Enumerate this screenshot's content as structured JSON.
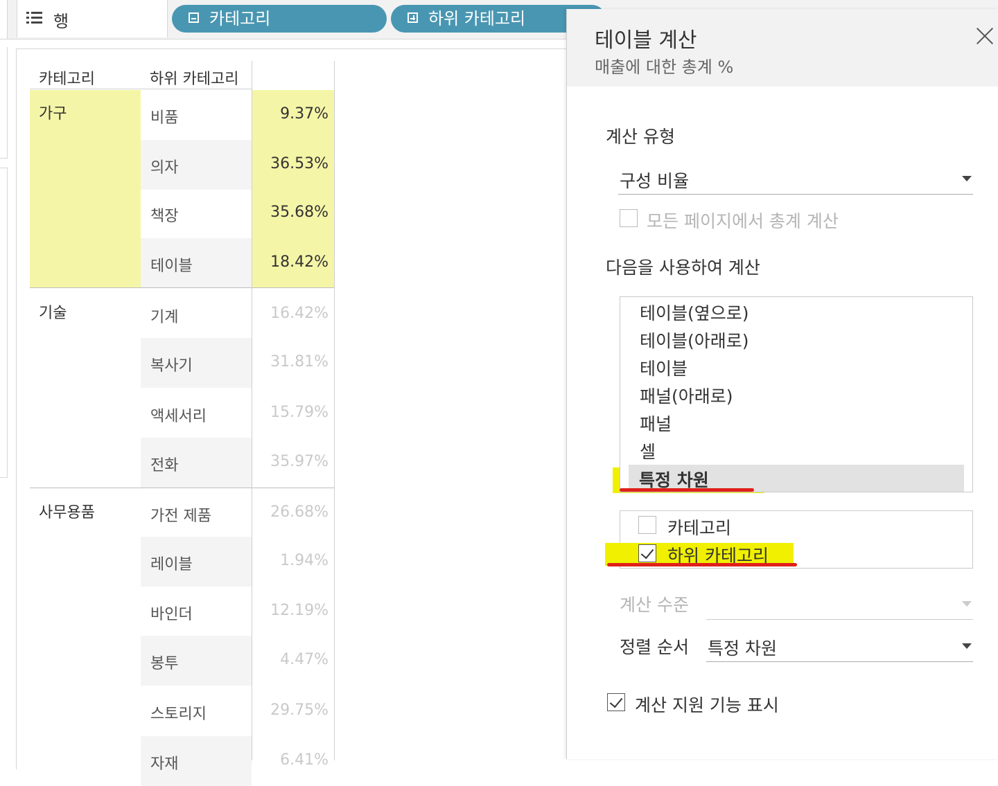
{
  "shelf": {
    "rows_label": "행",
    "pills": [
      {
        "label": "카테고리",
        "icon": "minus-box-icon"
      },
      {
        "label": "하위 카테고리",
        "icon": "plus-box-icon"
      }
    ]
  },
  "table": {
    "headers": {
      "category": "카테고리",
      "subcategory": "하위 카테고리"
    },
    "groups": [
      {
        "category": "가구",
        "rows": [
          {
            "sub": "비품",
            "value": "9.37%"
          },
          {
            "sub": "의자",
            "value": "36.53%"
          },
          {
            "sub": "책장",
            "value": "35.68%"
          },
          {
            "sub": "테이블",
            "value": "18.42%"
          }
        ]
      },
      {
        "category": "기술",
        "rows": [
          {
            "sub": "기계",
            "value": "16.42%"
          },
          {
            "sub": "복사기",
            "value": "31.81%"
          },
          {
            "sub": "액세서리",
            "value": "15.79%"
          },
          {
            "sub": "전화",
            "value": "35.97%"
          }
        ]
      },
      {
        "category": "사무용품",
        "rows": [
          {
            "sub": "가전 제품",
            "value": "26.68%"
          },
          {
            "sub": "레이블",
            "value": "1.94%"
          },
          {
            "sub": "바인더",
            "value": "12.19%"
          },
          {
            "sub": "봉투",
            "value": "4.47%"
          },
          {
            "sub": "스토리지",
            "value": "29.75%"
          },
          {
            "sub": "자재",
            "value": "6.41%"
          }
        ]
      }
    ],
    "highlight_color": "#f5f5a8"
  },
  "dialog": {
    "title": "테이블 계산",
    "subtitle": "매출에 대한 총계 %",
    "calc_type_label": "계산 유형",
    "calc_type_value": "구성 비율",
    "all_pages_label": "모든 페이지에서 총계 계산",
    "compute_using_label": "다음을 사용하여 계산",
    "compute_options": [
      "테이블(옆으로)",
      "테이블(아래로)",
      "테이블",
      "패널(아래로)",
      "패널",
      "셀",
      "특정 차원"
    ],
    "selected_option": "특정 차원",
    "dimensions": [
      {
        "label": "카테고리",
        "checked": false
      },
      {
        "label": "하위 카테고리",
        "checked": true
      }
    ],
    "level_label": "계산 수준",
    "sort_label": "정렬 순서",
    "sort_value": "특정 차원",
    "assist_label": "계산 지원 기능 표시",
    "annotation_highlight": "#f0f000",
    "annotation_underline": "#e0201a"
  }
}
